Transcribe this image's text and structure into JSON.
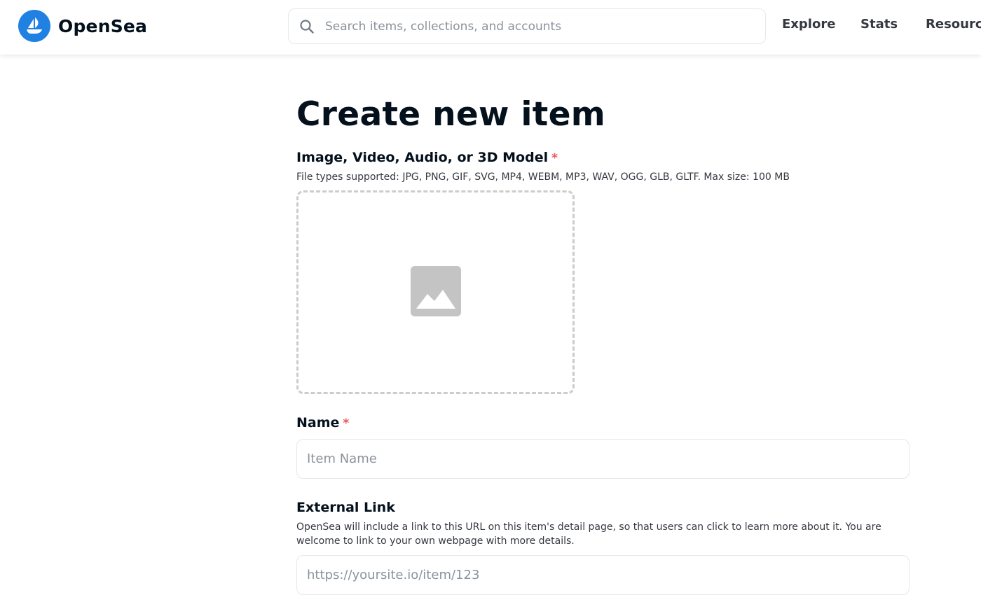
{
  "header": {
    "brand_name": "OpenSea",
    "search": {
      "placeholder": "Search items, collections, and accounts",
      "value": ""
    },
    "nav": {
      "explore": "Explore",
      "stats": "Stats",
      "resources": "Resources"
    }
  },
  "form": {
    "title": "Create new item",
    "media": {
      "label": "Image, Video, Audio, or 3D Model",
      "required_mark": "*",
      "helper": "File types supported: JPG, PNG, GIF, SVG, MP4, WEBM, MP3, WAV, OGG, GLB, GLTF. Max size: 100 MB"
    },
    "name": {
      "label": "Name",
      "required_mark": "*",
      "placeholder": "Item Name",
      "value": ""
    },
    "external_link": {
      "label": "External Link",
      "helper": "OpenSea will include a link to this URL on this item's detail page, so that users can click to learn more about it. You are welcome to link to your own webpage with more details.",
      "placeholder": "https://yoursite.io/item/123",
      "value": ""
    }
  },
  "colors": {
    "brand_blue": "#2081e2",
    "required_red": "#eb5757",
    "text_primary": "#04111d",
    "placeholder_gray": "#8a939b"
  },
  "icons": {
    "logo": "opensea-boat-icon",
    "search": "search-icon",
    "media_placeholder": "image-placeholder-icon"
  }
}
